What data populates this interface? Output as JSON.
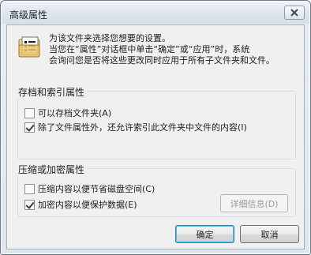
{
  "window": {
    "title": "高级属性"
  },
  "intro": {
    "lines": [
      "为该文件夹选择您想要的设置。",
      "当您在“属性”对话框中单击“确定”或“应用”时，系统",
      "会询问您是否将这些更改同时应用于所有子文件夹和文件。"
    ]
  },
  "archive_group": {
    "legend": "存档和索引属性",
    "items": [
      {
        "label": "可以存档文件夹(A)",
        "checked": false
      },
      {
        "label": "除了文件属性外，还允许索引此文件夹中文件的内容(I)",
        "checked": true
      }
    ]
  },
  "compress_group": {
    "legend": "压缩或加密属性",
    "items": [
      {
        "label": "压缩内容以便节省磁盘空间(C)",
        "checked": false
      },
      {
        "label": "加密内容以便保护数据(E)",
        "checked": true
      }
    ],
    "details_button": "详细信息(D)"
  },
  "buttons": {
    "ok": "确定",
    "cancel": "取消"
  },
  "icons": {
    "close": "close-icon",
    "info": "folder-properties-icon"
  }
}
